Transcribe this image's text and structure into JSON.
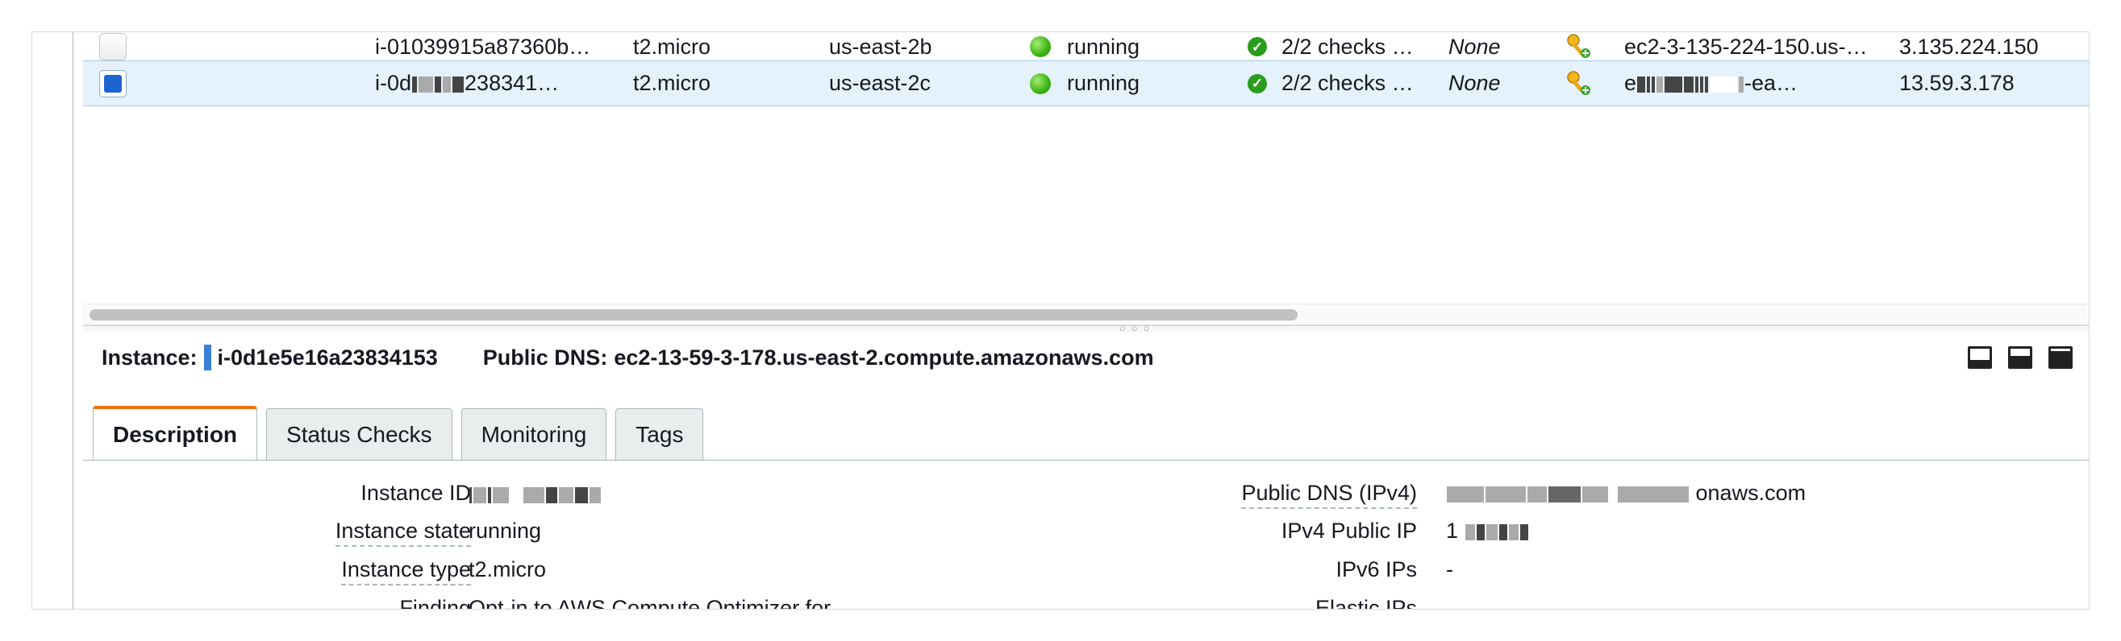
{
  "instances": [
    {
      "id": "i-01039915a87360b…",
      "type": "t2.micro",
      "zone": "us-east-2b",
      "state": "running",
      "checks": "2/2 checks …",
      "alarm": "None",
      "dns": "ec2-3-135-224-150.us-…",
      "ip": "3.135.224.150",
      "selected": false
    },
    {
      "id_prefix": "i-0d",
      "id_suffix": "238341…",
      "type": "t2.micro",
      "zone": "us-east-2c",
      "state": "running",
      "checks": "2/2 checks …",
      "alarm": "None",
      "dns_prefix": "e",
      "dns_suffix": "-ea…",
      "ip": "13.59.3.178",
      "selected": true
    }
  ],
  "details_header": {
    "instance_label": "Instance:",
    "instance_id": "i-0d1e5e16a23834153",
    "dns_label": "Public DNS:",
    "dns_value": "ec2-13-59-3-178.us-east-2.compute.amazonaws.com"
  },
  "tabs": [
    "Description",
    "Status Checks",
    "Monitoring",
    "Tags"
  ],
  "description": {
    "left": [
      {
        "label": "Instance ID",
        "value": ""
      },
      {
        "label": "Instance state",
        "value": "running"
      },
      {
        "label": "Instance type",
        "value": "t2.micro"
      },
      {
        "label": "Finding",
        "value": "Opt-in to AWS Compute Optimizer for"
      }
    ],
    "right": [
      {
        "label": "Public DNS (IPv4)",
        "value_suffix": "onaws.com"
      },
      {
        "label": "IPv4 Public IP",
        "value_prefix": "1"
      },
      {
        "label": "IPv6 IPs",
        "value": "-"
      },
      {
        "label": "Elastic IPs",
        "value": ""
      }
    ]
  },
  "colors": {
    "selected_row": "#e6f2fb",
    "running": "#39b312",
    "active_tab_accent": "#ec7211",
    "checkbox_checked": "#1c64d0"
  },
  "icons": {
    "state": "green-dot-icon",
    "checks": "green-check-icon",
    "key": "key-icon"
  }
}
